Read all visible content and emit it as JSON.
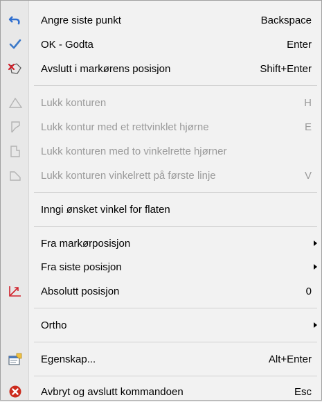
{
  "menu": {
    "items": [
      {
        "label": "Angre siste punkt",
        "shortcut": "Backspace",
        "icon": "undo-icon"
      },
      {
        "label": "OK - Godta",
        "shortcut": "Enter",
        "icon": "checkmark-icon"
      },
      {
        "label": "Avslutt i markørens posisjon",
        "shortcut": "Shift+Enter",
        "icon": "finish-at-cursor-icon"
      },
      {
        "label": "Lukk konturen",
        "shortcut": "H",
        "icon": "close-contour-icon"
      },
      {
        "label": "Lukk kontur med et rettvinklet hjørne",
        "shortcut": "E",
        "icon": "close-right-angle-icon"
      },
      {
        "label": "Lukk konturen med to vinkelrette hjørner",
        "shortcut": "",
        "icon": "close-two-right-angles-icon"
      },
      {
        "label": "Lukk konturen vinkelrett på første linje",
        "shortcut": "V",
        "icon": "close-perpendicular-icon"
      },
      {
        "label": "Inngi ønsket vinkel for flaten",
        "shortcut": ""
      },
      {
        "label": "Fra markørposisjon",
        "shortcut": "",
        "submenu": true
      },
      {
        "label": "Fra siste posisjon",
        "shortcut": "",
        "submenu": true
      },
      {
        "label": "Absolutt posisjon",
        "shortcut": "0",
        "icon": "absolute-position-icon"
      },
      {
        "label": "Ortho",
        "shortcut": "",
        "submenu": true
      },
      {
        "label": "Egenskap...",
        "shortcut": "Alt+Enter",
        "icon": "properties-icon"
      },
      {
        "label": "Avbryt og avslutt kommandoen",
        "shortcut": "Esc",
        "icon": "cancel-icon"
      }
    ]
  },
  "colors": {
    "undo": "#2f6fd0",
    "check": "#3a78c8",
    "cancel": "#cc2b1d",
    "disabled_text": "#9a9a9a"
  }
}
